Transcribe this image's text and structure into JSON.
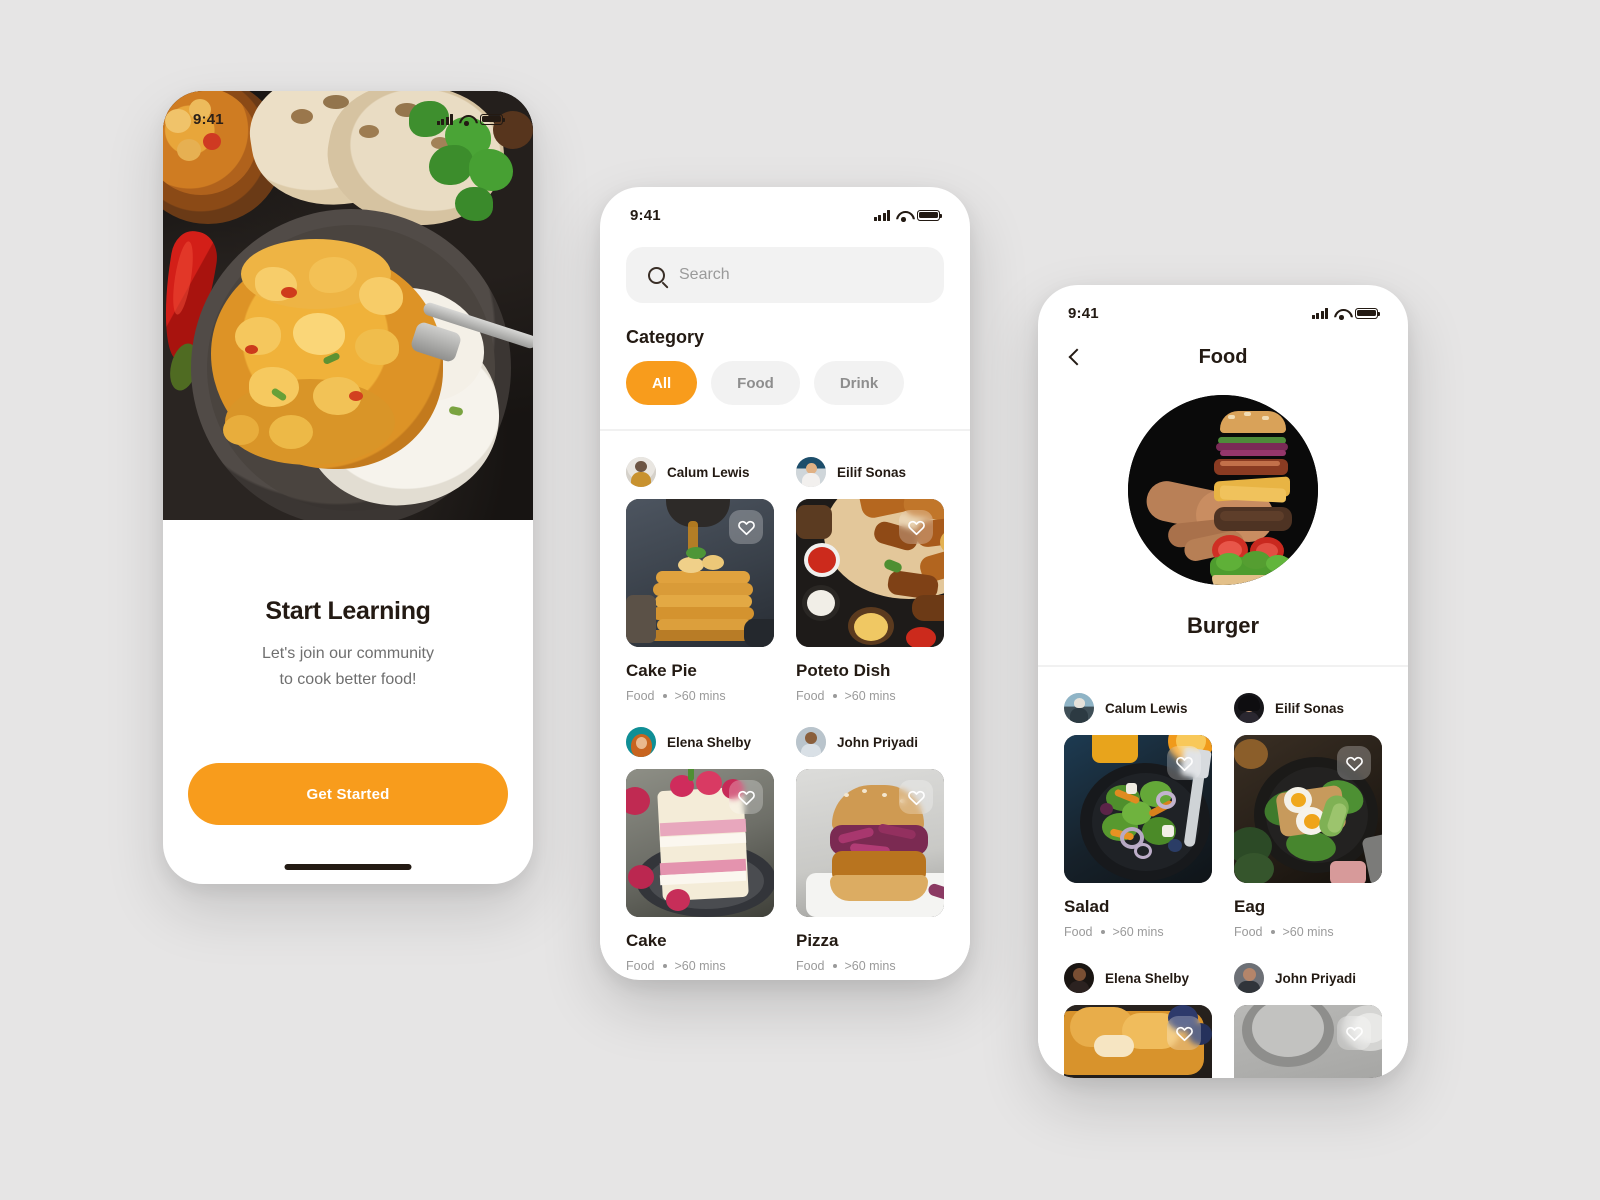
{
  "theme": {
    "background": "#e6e5e5",
    "accent": "#f89c1c",
    "text_primary": "#231a13",
    "text_muted": "#9a9a9a",
    "chip_bg": "#f2f2f2"
  },
  "onboarding": {
    "status": {
      "time": "9:41",
      "icons": [
        "signal-icon",
        "wifi-icon",
        "battery-icon"
      ]
    },
    "hero_image_alt": "curry-chicken-with-rice-and-flatbread",
    "title": "Start Learning",
    "subtitle_line1": "Let's join our community",
    "subtitle_line2": "to cook better food!",
    "cta_label": "Get Started"
  },
  "home": {
    "status": {
      "time": "9:41",
      "icons": [
        "signal-icon",
        "wifi-icon",
        "battery-icon"
      ]
    },
    "search": {
      "placeholder": "Search",
      "value": "",
      "icon": "search-icon"
    },
    "category_label": "Category",
    "chips": [
      {
        "label": "All",
        "active": true
      },
      {
        "label": "Food",
        "active": false
      },
      {
        "label": "Drink",
        "active": false
      }
    ],
    "recipes": [
      {
        "author": "Calum Lewis",
        "title": "Cake Pie",
        "category": "Food",
        "duration": ">60 mins",
        "image_alt": "pancake-stack-with-syrup",
        "favorite": false
      },
      {
        "author": "Eilif Sonas",
        "title": "Poteto Dish",
        "category": "Food",
        "duration": ">60 mins",
        "image_alt": "grilled-meat-platter-with-dips",
        "favorite": false
      },
      {
        "author": "Elena Shelby",
        "title": "Cake",
        "category": "Food",
        "duration": ">60 mins",
        "image_alt": "raspberry-layer-cake-slice",
        "favorite": false
      },
      {
        "author": "John Priyadi",
        "title": "Pizza",
        "category": "Food",
        "duration": ">60 mins",
        "image_alt": "fried-chicken-sandwich-with-slaw",
        "favorite": false
      }
    ]
  },
  "detail": {
    "status": {
      "time": "9:41",
      "icons": [
        "signal-icon",
        "wifi-icon",
        "battery-icon"
      ]
    },
    "nav": {
      "back_icon": "chevron-left-icon",
      "title": "Food"
    },
    "hero": {
      "name": "Burger",
      "image_alt": "exploded-burger-held-in-hand-on-black"
    },
    "recipes": [
      {
        "author": "Calum Lewis",
        "title": "Salad",
        "category": "Food",
        "duration": ">60 mins",
        "image_alt": "salad-bowl-with-fork-and-orange-juice",
        "favorite": false
      },
      {
        "author": "Eilif Sonas",
        "title": "Eag",
        "category": "Food",
        "duration": ">60 mins",
        "image_alt": "avocado-egg-toast-on-dark-plate",
        "favorite": false
      },
      {
        "author": "Elena Shelby",
        "title": "",
        "category": "",
        "duration": "",
        "image_alt": "glazed-pastry-with-blueberries",
        "favorite": false
      },
      {
        "author": "John Priyadi",
        "title": "",
        "category": "",
        "duration": "",
        "image_alt": "gray-plates-on-stone-surface",
        "favorite": false
      }
    ]
  }
}
